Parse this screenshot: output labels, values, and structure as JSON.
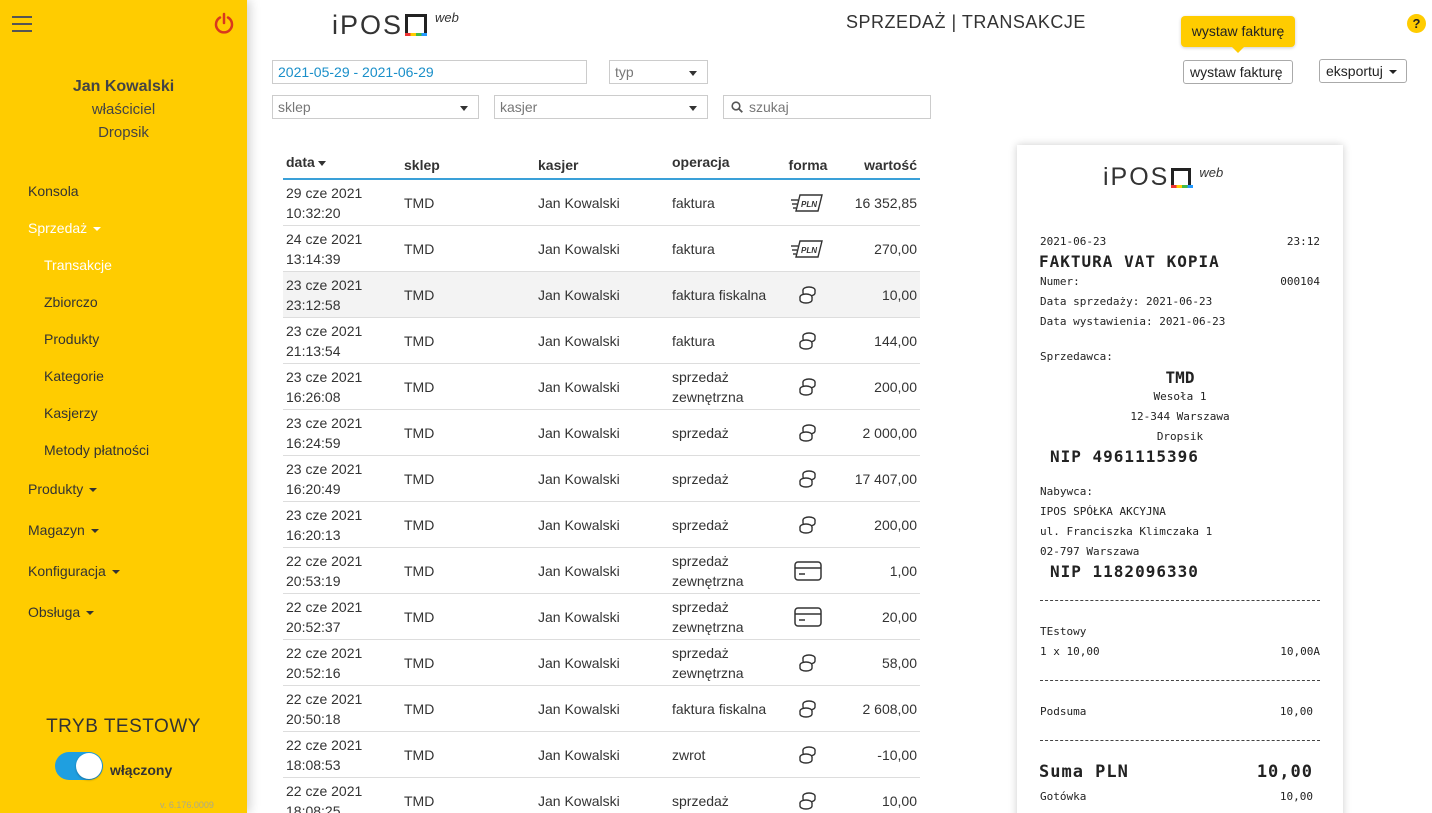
{
  "app": {
    "logo_text": "iPOS",
    "logo_suffix": "web",
    "page_title": "SPRZEDAŻ | TRANSAKCJE",
    "help": "?"
  },
  "sidebar": {
    "user_name": "Jan Kowalski",
    "user_role": "właściciel",
    "company": "Dropsik",
    "items": [
      {
        "label": "Konsola"
      },
      {
        "label": "Sprzedaż"
      },
      {
        "label": "Transakcje"
      },
      {
        "label": "Zbiorczo"
      },
      {
        "label": "Produkty"
      },
      {
        "label": "Kategorie"
      },
      {
        "label": "Kasjerzy"
      },
      {
        "label": "Metody płatności"
      },
      {
        "label": "Produkty"
      },
      {
        "label": "Magazyn"
      },
      {
        "label": "Konfiguracja"
      },
      {
        "label": "Obsługa"
      }
    ],
    "test_mode_label": "TRYB TESTOWY",
    "test_mode_state": "włączony",
    "version": "v. 6.176.0009",
    "accent_color": "#ffcc00",
    "toggle_color": "#1f9fe0"
  },
  "toolbar": {
    "tooltip": "wystaw fakturę",
    "invoice_button": "wystaw fakturę",
    "export_button": "eksportuj"
  },
  "filters": {
    "date_range": "2021-05-29 - 2021-06-29",
    "type_placeholder": "typ",
    "shop_placeholder": "sklep",
    "cashier_placeholder": "kasjer",
    "search_placeholder": "szukaj"
  },
  "table": {
    "columns": [
      "data",
      "sklep",
      "kasjer",
      "operacja",
      "forma",
      "wartość"
    ],
    "rows": [
      {
        "date": "29 cze 2021",
        "time": "10:32:20",
        "shop": "TMD",
        "cashier": "Jan Kowalski",
        "op1": "faktura",
        "op2": "",
        "form": "transfer-icon",
        "value": "16 352,85"
      },
      {
        "date": "24 cze 2021",
        "time": "13:14:39",
        "shop": "TMD",
        "cashier": "Jan Kowalski",
        "op1": "faktura",
        "op2": "",
        "form": "transfer-icon",
        "value": "270,00"
      },
      {
        "date": "23 cze 2021",
        "time": "23:12:58",
        "shop": "TMD",
        "cashier": "Jan Kowalski",
        "op1": "faktura fiskalna",
        "op2": "",
        "form": "coins-icon",
        "value": "10,00"
      },
      {
        "date": "23 cze 2021",
        "time": "21:13:54",
        "shop": "TMD",
        "cashier": "Jan Kowalski",
        "op1": "faktura",
        "op2": "",
        "form": "coins-icon",
        "value": "144,00"
      },
      {
        "date": "23 cze 2021",
        "time": "16:26:08",
        "shop": "TMD",
        "cashier": "Jan Kowalski",
        "op1": "sprzedaż",
        "op2": "zewnętrzna",
        "form": "coins-icon",
        "value": "200,00"
      },
      {
        "date": "23 cze 2021",
        "time": "16:24:59",
        "shop": "TMD",
        "cashier": "Jan Kowalski",
        "op1": "sprzedaż",
        "op2": "",
        "form": "coins-icon",
        "value": "2 000,00"
      },
      {
        "date": "23 cze 2021",
        "time": "16:20:49",
        "shop": "TMD",
        "cashier": "Jan Kowalski",
        "op1": "sprzedaż",
        "op2": "",
        "form": "coins-icon",
        "value": "17 407,00"
      },
      {
        "date": "23 cze 2021",
        "time": "16:20:13",
        "shop": "TMD",
        "cashier": "Jan Kowalski",
        "op1": "sprzedaż",
        "op2": "",
        "form": "coins-icon",
        "value": "200,00"
      },
      {
        "date": "22 cze 2021",
        "time": "20:53:19",
        "shop": "TMD",
        "cashier": "Jan Kowalski",
        "op1": "sprzedaż",
        "op2": "zewnętrzna",
        "form": "card-icon",
        "value": "1,00"
      },
      {
        "date": "22 cze 2021",
        "time": "20:52:37",
        "shop": "TMD",
        "cashier": "Jan Kowalski",
        "op1": "sprzedaż",
        "op2": "zewnętrzna",
        "form": "card-icon",
        "value": "20,00"
      },
      {
        "date": "22 cze 2021",
        "time": "20:52:16",
        "shop": "TMD",
        "cashier": "Jan Kowalski",
        "op1": "sprzedaż",
        "op2": "zewnętrzna",
        "form": "coins-icon",
        "value": "58,00"
      },
      {
        "date": "22 cze 2021",
        "time": "20:50:18",
        "shop": "TMD",
        "cashier": "Jan Kowalski",
        "op1": "faktura fiskalna",
        "op2": "",
        "form": "coins-icon",
        "value": "2 608,00"
      },
      {
        "date": "22 cze 2021",
        "time": "18:08:53",
        "shop": "TMD",
        "cashier": "Jan Kowalski",
        "op1": "zwrot",
        "op2": "",
        "form": "coins-icon",
        "value": "-10,00"
      },
      {
        "date": "22 cze 2021",
        "time": "18:08:25",
        "shop": "TMD",
        "cashier": "Jan Kowalski",
        "op1": "sprzedaż",
        "op2": "",
        "form": "coins-icon",
        "value": "10,00"
      }
    ]
  },
  "receipt": {
    "date": "2021-06-23",
    "time": "23:12",
    "title": "FAKTURA VAT KOPIA",
    "number_label": "Numer:",
    "number": "000104",
    "sale_date": "Data sprzedaży:   2021-06-23",
    "issue_date": "Data wystawienia:  2021-06-23",
    "seller_label": "Sprzedawca:",
    "seller_name": "TMD",
    "seller_street": "Wesoła 1",
    "seller_city": "12-344 Warszawa",
    "seller_company": "Dropsik",
    "seller_nip": "NIP 4961115396",
    "buyer_label": "Nabywca:",
    "buyer_name": "IPOS SPÓŁKA AKCYJNA",
    "buyer_street": "ul. Franciszka Klimczaka 1",
    "buyer_city": "02-797 Warszawa",
    "buyer_nip": "NIP 1182096330",
    "item_name": "TEstowy",
    "item_qty": "1 x 10,00",
    "item_total": "10,00A",
    "subtotal_label": "Podsuma",
    "subtotal": "10,00",
    "sum_label": "Suma PLN",
    "sum": "10,00",
    "cash_label": "Gotówka",
    "cash": "10,00"
  }
}
